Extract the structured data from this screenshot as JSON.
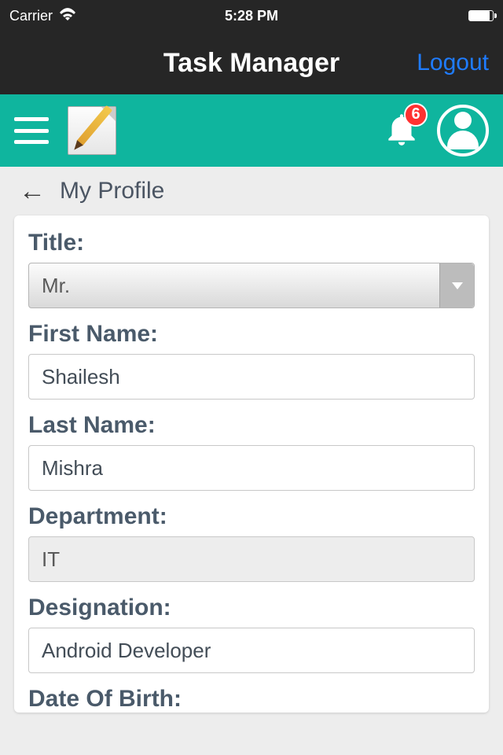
{
  "status": {
    "carrier": "Carrier",
    "time": "5:28 PM"
  },
  "header": {
    "title": "Task Manager",
    "logout": "Logout"
  },
  "toolbar": {
    "badge_count": "6"
  },
  "breadcrumb": {
    "title": "My Profile"
  },
  "form": {
    "title_label": "Title:",
    "title_value": "Mr.",
    "first_name_label": "First Name:",
    "first_name_value": "Shailesh",
    "last_name_label": "Last Name:",
    "last_name_value": "Mishra",
    "department_label": "Department:",
    "department_value": "IT",
    "designation_label": "Designation:",
    "designation_value": "Android Developer",
    "dob_label": "Date Of Birth:"
  }
}
